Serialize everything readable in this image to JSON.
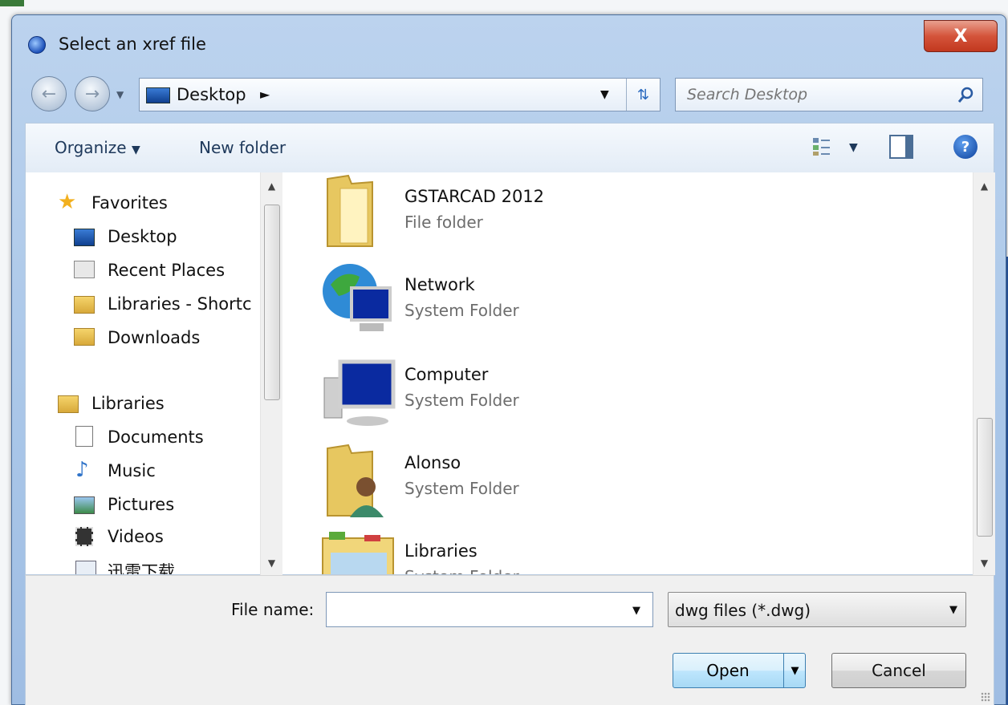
{
  "window": {
    "title": "Select an xref file",
    "close_label": "X"
  },
  "nav": {
    "back_icon": "back-arrow-icon",
    "forward_icon": "forward-arrow-icon",
    "address": "Desktop",
    "search_placeholder": "Search Desktop"
  },
  "toolbar": {
    "organize_label": "Organize",
    "new_folder_label": "New folder",
    "help_label": "?"
  },
  "sidebar": {
    "items": [
      {
        "label": "Favorites",
        "icon": "star-icon"
      },
      {
        "label": "Desktop",
        "icon": "desktop-icon"
      },
      {
        "label": "Recent Places",
        "icon": "recent-places-icon"
      },
      {
        "label": "Libraries - Shortc",
        "icon": "library-shortcut-icon"
      },
      {
        "label": "Downloads",
        "icon": "downloads-icon"
      },
      {
        "label": "Libraries",
        "icon": "libraries-icon"
      },
      {
        "label": "Documents",
        "icon": "documents-icon"
      },
      {
        "label": "Music",
        "icon": "music-icon"
      },
      {
        "label": "Pictures",
        "icon": "pictures-icon"
      },
      {
        "label": "Videos",
        "icon": "videos-icon"
      },
      {
        "label": "迅雷下载",
        "icon": "download-folder-icon"
      }
    ]
  },
  "files": [
    {
      "name": "GSTARCAD 2012",
      "type": "File folder",
      "icon": "folder-icon"
    },
    {
      "name": "Network",
      "type": "System Folder",
      "icon": "network-icon"
    },
    {
      "name": "Computer",
      "type": "System Folder",
      "icon": "computer-icon"
    },
    {
      "name": "Alonso",
      "type": "System Folder",
      "icon": "user-folder-icon"
    },
    {
      "name": "Libraries",
      "type": "System Folder",
      "icon": "libraries-folder-icon"
    }
  ],
  "bottom": {
    "file_name_label": "File name:",
    "file_name_value": "",
    "file_type": "dwg files (*.dwg)",
    "open_label": "Open",
    "cancel_label": "Cancel"
  },
  "colors": {
    "frame": "#a9c6e8",
    "close_red": "#c2381f",
    "toolbar_text": "#1e395b"
  }
}
